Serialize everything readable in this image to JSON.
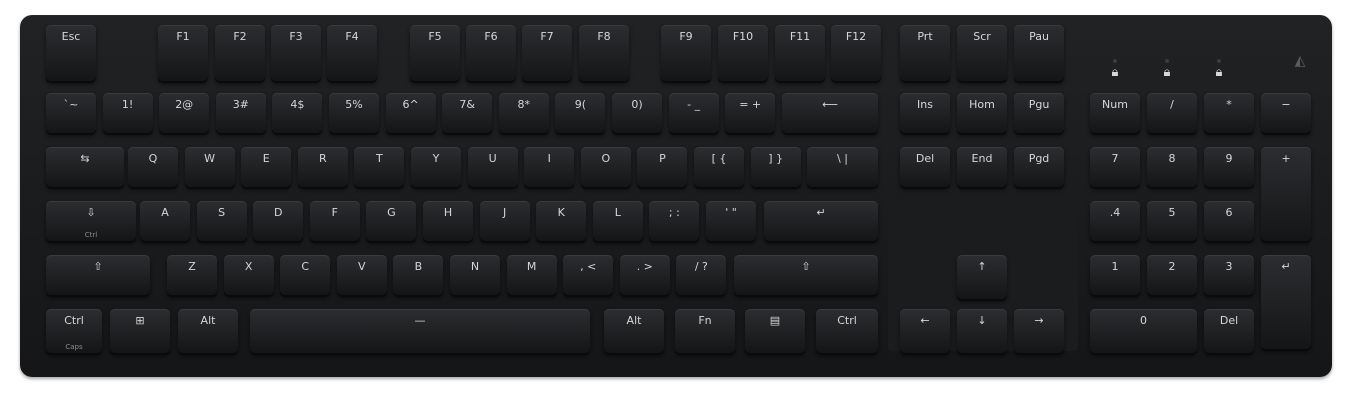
{
  "keyboard": {
    "fn_row": [
      "Esc",
      "F1",
      "F2",
      "F3",
      "F4",
      "F5",
      "F6",
      "F7",
      "F8",
      "F9",
      "F10",
      "F11",
      "F12"
    ],
    "nav_top": [
      "Prt",
      "Scr",
      "Pau"
    ],
    "number_row": [
      "`~",
      "1!",
      "2@",
      "3#",
      "4$",
      "5%",
      "6^",
      "7&",
      "8*",
      "9(",
      "0)",
      "- _",
      "= +"
    ],
    "backspace": "⟵",
    "nav_mid": [
      "Ins",
      "Hom",
      "Pgu"
    ],
    "num_row1": [
      "Num",
      "/",
      "*",
      "−"
    ],
    "q_row": [
      "Q",
      "W",
      "E",
      "R",
      "T",
      "Y",
      "U",
      "I",
      "O",
      "P",
      "[ {",
      "] }",
      "\\ |"
    ],
    "tab": "⇆",
    "nav_bot": [
      "Del",
      "End",
      "Pgd"
    ],
    "num_row2": [
      "7",
      "8",
      "9"
    ],
    "num_plus": "+",
    "a_row": [
      "A",
      "S",
      "D",
      "F",
      "G",
      "H",
      "J",
      "K",
      "L",
      "; :",
      "' \""
    ],
    "caps": "⇩",
    "caps_sub": "Ctrl",
    "enter": "↵",
    "num_row3": [
      ".4",
      "5",
      "6"
    ],
    "z_row": [
      "Z",
      "X",
      "C",
      "V",
      "B",
      "N",
      "M",
      ", <",
      ". >",
      "/ ?"
    ],
    "shift_left": "⇧",
    "shift_right": "⇧",
    "num_row4": [
      "1",
      "2",
      "3"
    ],
    "num_enter": "↵",
    "ctrl_left": "Ctrl",
    "ctrl_left_sub": "Caps",
    "win": "⊞",
    "alt_left": "Alt",
    "space": "—",
    "alt_right": "Alt",
    "fn": "Fn",
    "menu": "▤",
    "ctrl_right": "Ctrl",
    "arrow_up": "↑",
    "arrow_left": "←",
    "arrow_down": "↓",
    "arrow_right": "→",
    "num_zero": "0",
    "num_del": "Del",
    "lock_icon": "🔒︎",
    "colors": {
      "body": "#1a1b1d",
      "keycap": "#232427",
      "legend": "#d4d6d8"
    }
  }
}
